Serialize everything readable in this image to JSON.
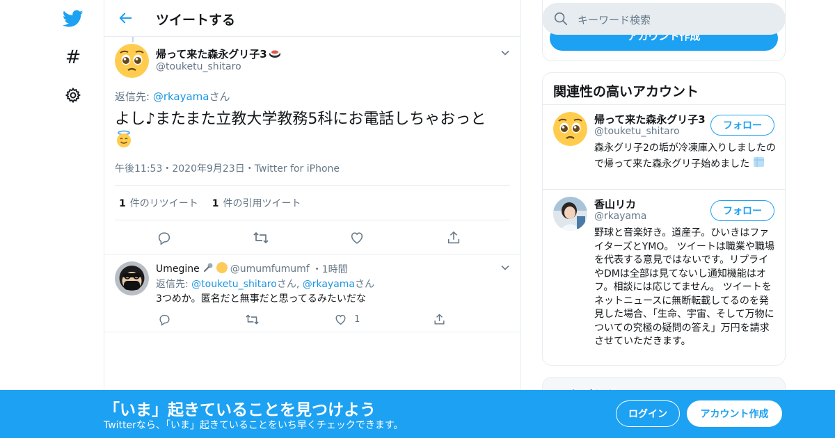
{
  "header": {
    "title": "ツイートする"
  },
  "tweet": {
    "name": "帰って来た森永グリ子3",
    "handle": "@touketu_shitaro",
    "reply_prefix": "返信先: ",
    "reply_to": "@rkayama",
    "reply_suffix": "さん",
    "text": "よし♪またまた立教大学教務5科にお電話しちゃおっと",
    "meta": "午後11:53・2020年9月23日・Twitter for iPhone",
    "retweet_count": "1",
    "retweet_label": "件のリツイート",
    "quote_count": "1",
    "quote_label": "件の引用ツイート"
  },
  "reply": {
    "name": "Umegine",
    "handle": "@umumfumumf",
    "time": "・1時間",
    "reply_prefix": "返信先: ",
    "reply_to_1": "@touketu_shitaro",
    "reply_mid": "さん, ",
    "reply_to_2": "@rkayama",
    "reply_suffix": "さん",
    "text": "3つめか。匿名だと無事だと思ってるみたいだな",
    "like_count": "1"
  },
  "sidebar": {
    "search_placeholder": "キーワード検索",
    "signup_label": "アカウント作成",
    "related_title": "関連性の高いアカウント",
    "accounts": [
      {
        "name": "帰って来た森永グリ子3",
        "handle": "@touketu_shitaro",
        "follow_label": "フォロー",
        "bio": "森永グリ子2の垢が冷凍庫入りしましたので帰って来た森永グリ子始めました"
      },
      {
        "name": "香山リカ",
        "handle": "@rkayama",
        "follow_label": "フォロー",
        "bio": "野球と音楽好き。道産子。ひいきはファイターズとYMO。 ツイートは職業や職場を代表する意見ではないです。リプライやDMは全部は見てないし通知機能はオフ。相談には応じてません。 ツイートをネットニュースに無断転載してるのを発見した場合、「生命、宇宙、そして万物についての究極の疑問の答え」万円を請求させていただきます。"
      }
    ],
    "trends_title": "いまどうしてる？"
  },
  "bottom_bar": {
    "title": "「いま」起きていることを見つけよう",
    "subtitle": "Twitterなら、「いま」起きていることをいち早くチェックできます。",
    "login_label": "ログイン",
    "signup_label": "アカウント作成"
  },
  "colors": {
    "accent": "#1da1f2",
    "link": "#1b95e0",
    "muted": "#657786",
    "border": "#e6ecf0"
  },
  "icons": [
    "twitter-bird-icon",
    "hashtag-icon",
    "gear-icon",
    "back-arrow-icon",
    "chevron-down-icon",
    "reply-icon",
    "retweet-icon",
    "like-icon",
    "share-icon",
    "search-icon",
    "sushi-emoji",
    "angel-emoji",
    "ice-emoji",
    "microphone-emoji",
    "yellow-circle-emoji"
  ]
}
